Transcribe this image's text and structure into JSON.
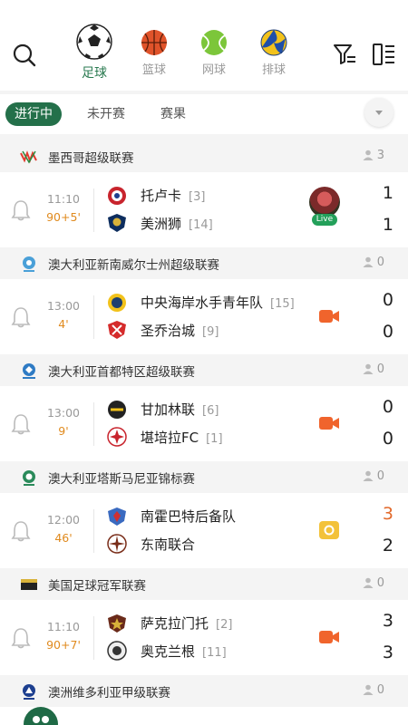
{
  "sports": [
    {
      "label": "足球",
      "icon": "soccer-ball-icon",
      "active": true
    },
    {
      "label": "篮球",
      "icon": "basketball-icon",
      "active": false
    },
    {
      "label": "网球",
      "icon": "tennis-ball-icon",
      "active": false
    },
    {
      "label": "排球",
      "icon": "volleyball-icon",
      "active": false
    }
  ],
  "status_tabs": [
    {
      "label": "进行中",
      "active": true
    },
    {
      "label": "未开赛",
      "active": false
    },
    {
      "label": "赛果",
      "active": false
    }
  ],
  "colors": {
    "brand": "#24704a",
    "minute": "#e08a1e",
    "hot_score": "#e26a2c",
    "video": "#f0642c",
    "animation": "#f3c23a"
  },
  "leagues": [
    {
      "name": "墨西哥超级联赛",
      "count": "3",
      "match": {
        "time": "11:10",
        "minute": "90+5'",
        "media": "live",
        "live_label": "Live",
        "home": {
          "name": "托卢卡",
          "rank": "[3]",
          "score": "1"
        },
        "away": {
          "name": "美洲狮",
          "rank": "[14]",
          "score": "1"
        }
      }
    },
    {
      "name": "澳大利亚新南威尔士州超级联赛",
      "count": "0",
      "match": {
        "time": "13:00",
        "minute": "4'",
        "media": "video",
        "home": {
          "name": "中央海岸水手青年队",
          "rank": "[15]",
          "score": "0"
        },
        "away": {
          "name": "圣乔治城",
          "rank": "[9]",
          "score": "0"
        }
      }
    },
    {
      "name": "澳大利亚首都特区超级联赛",
      "count": "0",
      "match": {
        "time": "13:00",
        "minute": "9'",
        "media": "video",
        "home": {
          "name": "甘加林联",
          "rank": "[6]",
          "score": "0"
        },
        "away": {
          "name": "堪培拉FC",
          "rank": "[1]",
          "score": "0"
        }
      }
    },
    {
      "name": "澳大利亚塔斯马尼亚锦标赛",
      "count": "0",
      "match": {
        "time": "12:00",
        "minute": "46'",
        "media": "animation",
        "home": {
          "name": "南霍巴特后备队",
          "rank": "",
          "score": "3",
          "hot": true
        },
        "away": {
          "name": "东南联合",
          "rank": "",
          "score": "2"
        }
      }
    },
    {
      "name": "美国足球冠军联赛",
      "count": "0",
      "match": {
        "time": "11:10",
        "minute": "90+7'",
        "media": "video",
        "home": {
          "name": "萨克拉门托",
          "rank": "[2]",
          "score": "3"
        },
        "away": {
          "name": "奥克兰根",
          "rank": "[11]",
          "score": "3"
        }
      }
    },
    {
      "name": "澳洲维多利亚甲级联赛",
      "count": "0",
      "match": null
    }
  ]
}
